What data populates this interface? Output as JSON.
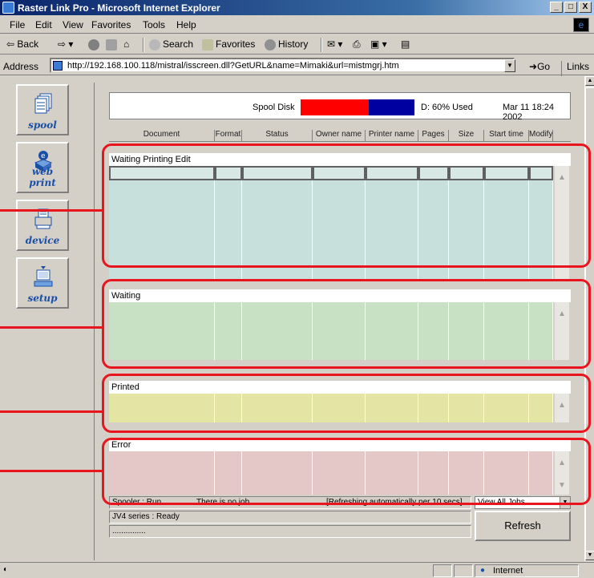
{
  "window": {
    "title": "Raster Link Pro - Microsoft Internet Explorer",
    "controls": {
      "minimize": "_",
      "maximize": "□",
      "close": "X"
    }
  },
  "menu": [
    "File",
    "Edit",
    "View",
    "Favorites",
    "Tools",
    "Help"
  ],
  "toolbar": {
    "back": "Back",
    "search": "Search",
    "favorites": "Favorites",
    "history": "History"
  },
  "address": {
    "label": "Address",
    "url": "http://192.168.100.118/mistral/isscreen.dll?GetURL&name=Mimaki&url=mistmgrj.htm",
    "go": "Go",
    "links": "Links »"
  },
  "sidebar": [
    {
      "label": "spool",
      "icon": "spool-icon"
    },
    {
      "label": "web print",
      "icon": "web-print-icon"
    },
    {
      "label": "device",
      "icon": "device-icon"
    },
    {
      "label": "setup",
      "icon": "setup-icon"
    }
  ],
  "spool": {
    "label": "Spool Disk",
    "used_fraction": 0.6,
    "used_text": "D: 60% Used",
    "datetime": "Mar 11 18:24 2002",
    "colors": {
      "used": "#ff0000",
      "free": "#0000a0"
    }
  },
  "columns": [
    "Document",
    "Format",
    "Status",
    "Owner name",
    "Printer name",
    "Pages",
    "Size",
    "Start time",
    "Modify"
  ],
  "sections": [
    {
      "title": "Waiting Printing Edit",
      "color": "#c8e0dc",
      "rows": 8
    },
    {
      "title": "Waiting",
      "color": "#c8e0c4",
      "rows": 4
    },
    {
      "title": "Printed",
      "color": "#e4e4a4",
      "rows": 2
    },
    {
      "title": "Error",
      "color": "#e4c8c8",
      "rows": 3
    }
  ],
  "footer": {
    "spooler": "Spooler : Run",
    "jobs": "There is no job.",
    "refresh_note": "[Refreshing automatically per 10 secs]",
    "printer": "JV4 series : Ready",
    "progress": "...............",
    "view_select": "View All Jobs",
    "refresh_button": "Refresh"
  },
  "status": {
    "zone": "Internet"
  },
  "annotation_color": "#e8141e"
}
